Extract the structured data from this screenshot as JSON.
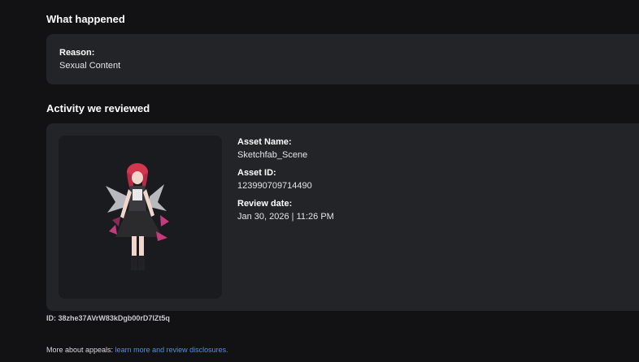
{
  "what_happened": {
    "title": "What happened",
    "reason_label": "Reason:",
    "reason_value": "Sexual Content"
  },
  "activity": {
    "title": "Activity we reviewed",
    "asset_name_label": "Asset Name:",
    "asset_name_value": "Sketchfab_Scene",
    "asset_id_label": "Asset ID:",
    "asset_id_value": "123990709714490",
    "review_date_label": "Review date:",
    "review_date_value": "Jan 30, 2026 | 11:26 PM"
  },
  "footer": {
    "id_text": "ID: 38zhe37AVrW83kDgb00rD7lZt5q",
    "appeals_prefix": "More about appeals: ",
    "appeals_link": "learn more and review disclosures."
  },
  "colors": {
    "background": "#121215",
    "card": "#232427",
    "link": "#4f8cff",
    "character_hair": "#d2374f",
    "character_outfit": "#2b2b2e",
    "character_accent": "#c43a7a"
  }
}
